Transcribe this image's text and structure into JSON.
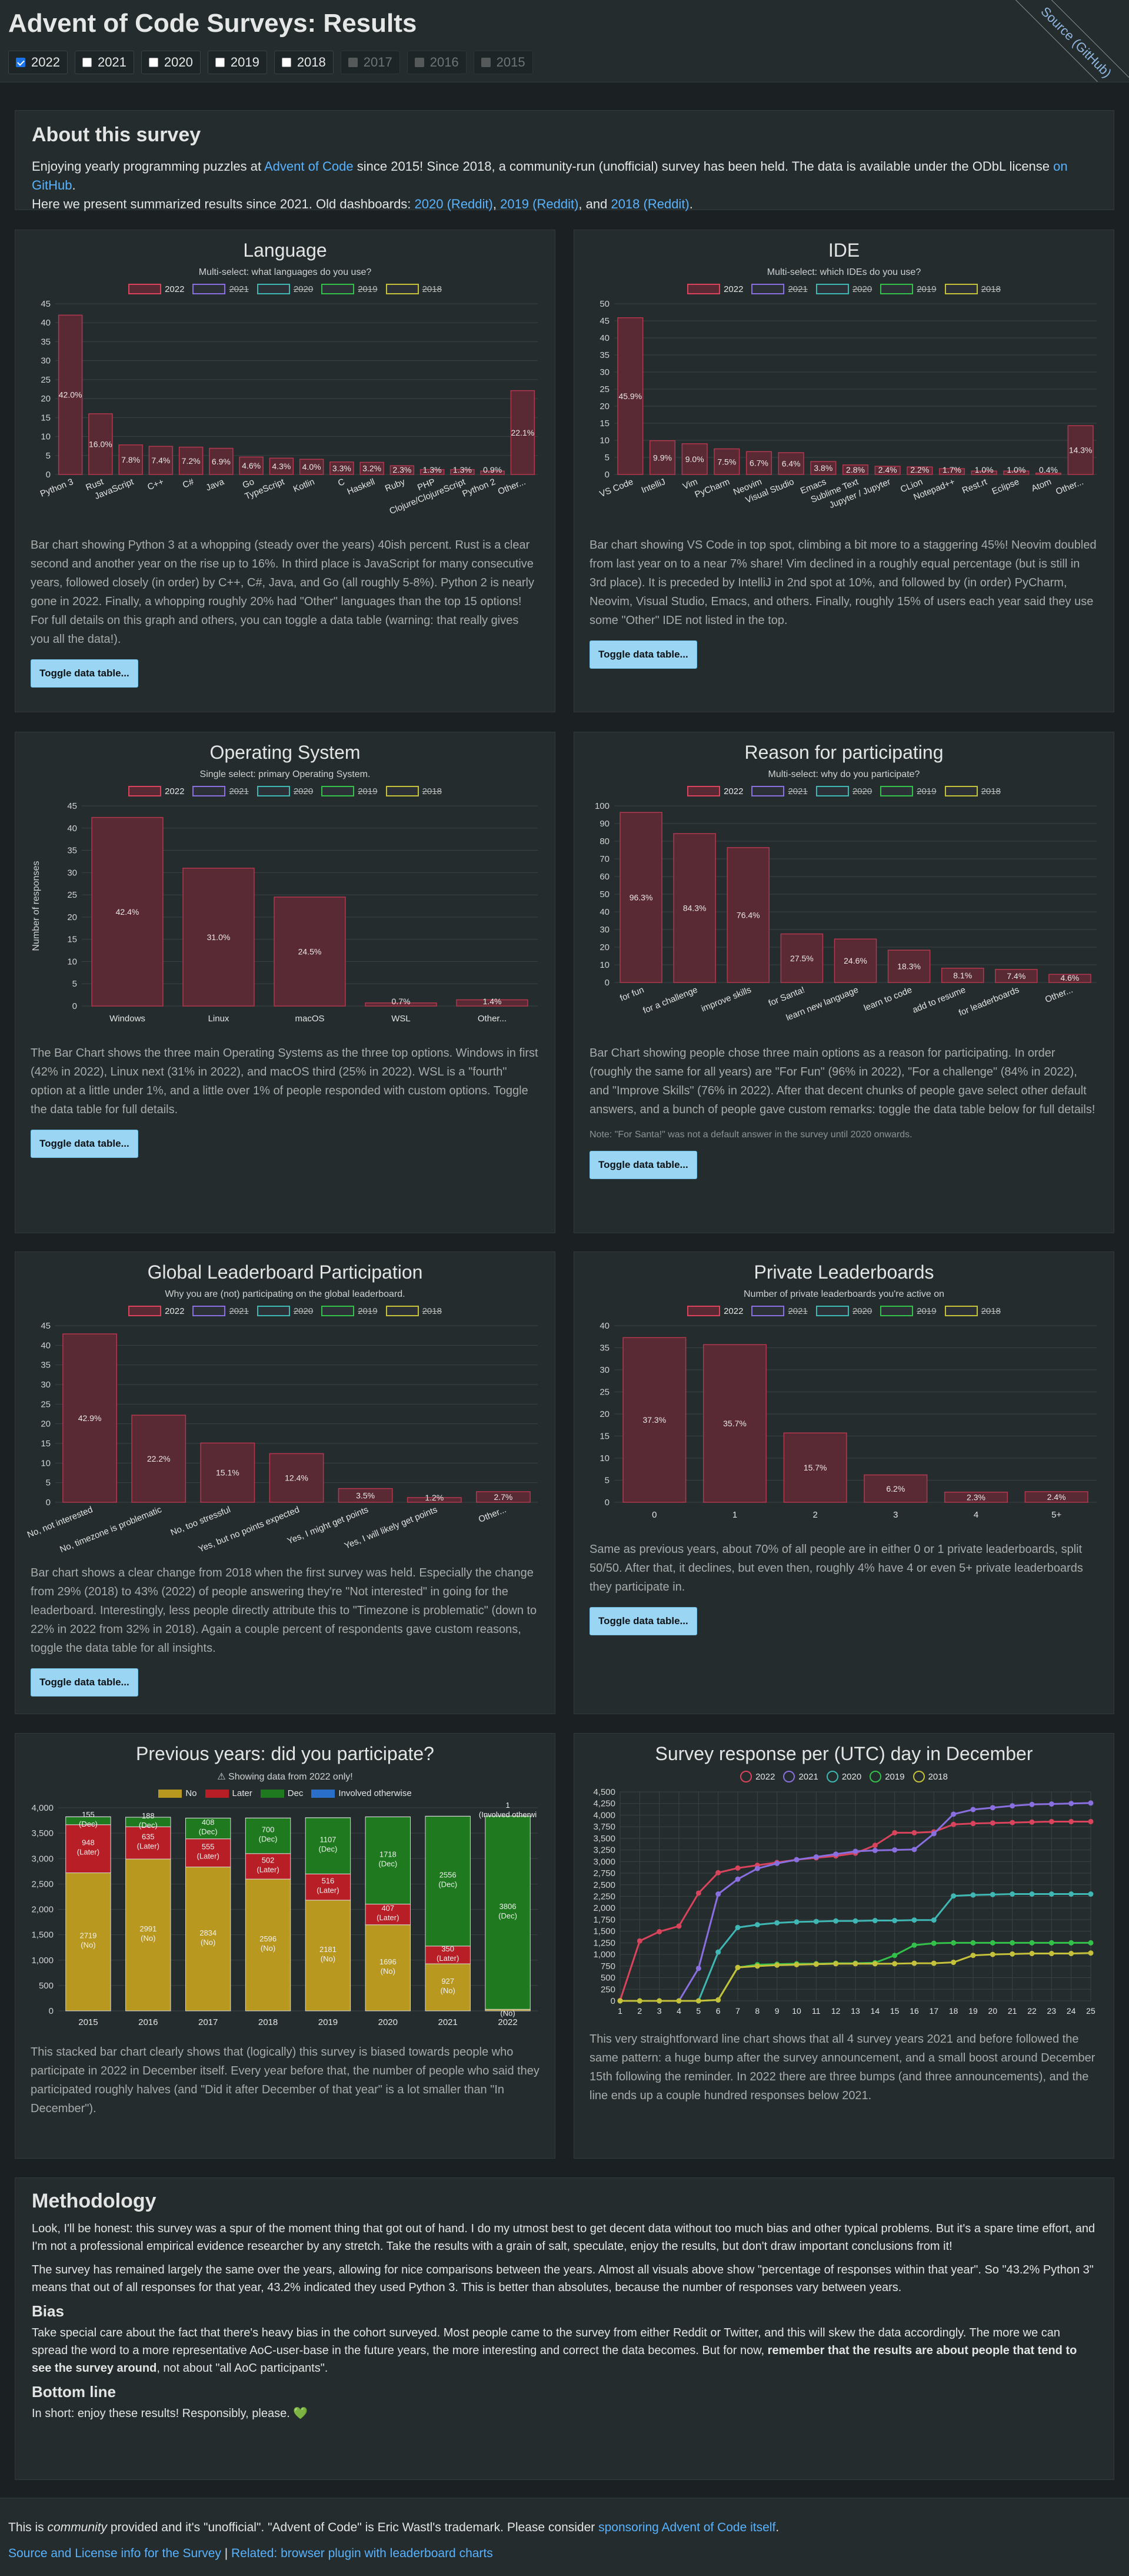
{
  "header": {
    "title": "Advent of Code Surveys: Results",
    "ribbon": "Source (GitHub)",
    "years": [
      {
        "label": "2022",
        "checked": true,
        "disabled": false
      },
      {
        "label": "2021",
        "checked": false,
        "disabled": false
      },
      {
        "label": "2020",
        "checked": false,
        "disabled": false
      },
      {
        "label": "2019",
        "checked": false,
        "disabled": false
      },
      {
        "label": "2018",
        "checked": false,
        "disabled": false
      },
      {
        "label": "2017",
        "checked": false,
        "disabled": true
      },
      {
        "label": "2016",
        "checked": false,
        "disabled": true
      },
      {
        "label": "2015",
        "checked": false,
        "disabled": true
      }
    ]
  },
  "about": {
    "title": "About this survey",
    "p1": "Enjoying yearly programming puzzles at ",
    "link_aoc": "Advent of Code",
    "p2": " since 2015! Since 2018, a community-run (unofficial) survey has been held. The data is available under the ODbL license ",
    "link_github": "on GitHub",
    "p3": ".",
    "p4": "Here we present summarized results since 2021. Old dashboards: ",
    "link_2020": "2020 (Reddit)",
    "sep1": ", ",
    "link_2019": "2019 (Reddit)",
    "sep2": ", and ",
    "link_2018": "2018 (Reddit)",
    "p5": "."
  },
  "legend_years": [
    "2022",
    "2021",
    "2020",
    "2019",
    "2018"
  ],
  "colors": {
    "y2022": "#d9435c",
    "y2021": "#8a6fe0",
    "y2020": "#3fb7b4",
    "y2019": "#33c14a",
    "y2018": "#c6c13a",
    "bar_fill": "#5a2a34",
    "bar_stroke": "#b3384f",
    "no": "#b8981e",
    "later": "#b81e26",
    "dec": "#1f7a1f",
    "other": "#2a6fc9"
  },
  "toggle_label": "Toggle data table...",
  "language": {
    "title": "Language",
    "subtitle": "Multi-select: what languages do you use?",
    "desc": "Bar chart showing Python 3 at a whopping (steady over the years) 40ish percent. Rust is a clear second and another year on the rise up to 16%. In third place is JavaScript for many consecutive years, followed closely (in order) by C++, C#, Java, and Go (all roughly 5-8%). Python 2 is nearly gone in 2022. Finally, a whopping roughly 20% had \"Other\" languages than the top 15 options! For full details on this graph and others, you can toggle a data table (warning: that really gives you all the data!)."
  },
  "ide": {
    "title": "IDE",
    "subtitle": "Multi-select: which IDEs do you use?",
    "desc": "Bar chart showing VS Code in top spot, climbing a bit more to a staggering 45%! Neovim doubled from last year on to a near 7% share! Vim declined in a roughly equal percentage (but is still in 3rd place). It is preceded by IntelliJ in 2nd spot at 10%, and followed by (in order) PyCharm, Neovim, Visual Studio, Emacs, and others. Finally, roughly 15% of users each year said they use some \"Other\" IDE not listed in the top."
  },
  "os": {
    "title": "Operating System",
    "subtitle": "Single select: primary Operating System.",
    "ylabel": "Number of responses",
    "desc": "The Bar Chart shows the three main Operating Systems as the three top options. Windows in first (42% in 2022), Linux next (31% in 2022), and macOS third (25% in 2022). WSL is a \"fourth\" option at a little under 1%, and a little over 1% of people responded with custom options. Toggle the data table for full details."
  },
  "reason": {
    "title": "Reason for participating",
    "subtitle": "Multi-select: why do you participate?",
    "desc": "Bar Chart showing people chose three main options as a reason for participating. In order (roughly the same for all years) are \"For Fun\" (96% in 2022), \"For a challenge\" (84% in 2022), and \"Improve Skills\" (76% in 2022). After that decent chunks of people gave select other default answers, and a bunch of people gave custom remarks: toggle the data table below for full details!",
    "note": "Note: \"For Santa!\" was not a default answer in the survey until 2020 onwards."
  },
  "global": {
    "title": "Global Leaderboard Participation",
    "subtitle": "Why you are (not) participating on the global leaderboard.",
    "desc": "Bar chart shows a clear change from 2018 when the first survey was held. Especially the change from 29% (2018) to 43% (2022) of people answering they're \"Not interested\" in going for the leaderboard. Interestingly, less people directly attribute this to \"Timezone is problematic\" (down to 22% in 2022 from 32% in 2018). Again a couple percent of respondents gave custom reasons, toggle the data table for all insights."
  },
  "private": {
    "title": "Private Leaderboards",
    "subtitle": "Number of private leaderboards you're active on",
    "desc": "Same as previous years, about 70% of all people are in either 0 or 1 private leaderboards, split 50/50. After that, it declines, but even then, roughly 4% have 4 or even 5+ private leaderboards they participate in."
  },
  "previous": {
    "title": "Previous years: did you participate?",
    "warning": "⚠ Showing data from 2022 only!",
    "legend": [
      "No",
      "Later",
      "Dec",
      "Involved otherwise"
    ],
    "desc": "This stacked bar chart clearly shows that (logically) this survey is biased towards people who participate in 2022 in December itself. Every year before that, the number of people who said they participated roughly halves (and \"Did it after December of that year\" is a lot smaller than \"In December\")."
  },
  "daily": {
    "title": "Survey response per (UTC) day in December",
    "desc": "This very straightforward line chart shows that all 4 survey years 2021 and before followed the same pattern: a huge bump after the survey announcement, and a small boost around December 15th following the reminder. In 2022 there are three bumps (and three announcements), and the line ends up a couple hundred responses below 2021."
  },
  "method": {
    "title": "Methodology",
    "p1": "Look, I'll be honest: this survey was a spur of the moment thing that got out of hand. I do my utmost best to get decent data without too much bias and other typical problems. But it's a spare time effort, and I'm not a professional empirical evidence researcher by any stretch. Take the results with a grain of salt, speculate, enjoy the results, but don't draw important conclusions from it!",
    "p2": "The survey has remained largely the same over the years, allowing for nice comparisons between the years. Almost all visuals above show \"percentage of responses within that year\". So \"43.2% Python 3\" means that out of all responses for that year, 43.2% indicated they used Python 3. This is better than absolutes, because the number of responses vary between years.",
    "bias_title": "Bias",
    "p3a": "Take special care about the fact that there's heavy bias in the cohort surveyed. Most people came to the survey from either Reddit or Twitter, and this will skew the data accordingly. The more we can spread the word to a more representative AoC-user-base in the future years, the more interesting and correct the data becomes. But for now, ",
    "p3b": "remember that the results are about people that tend to see the survey around",
    "p3c": ", not about \"all AoC participants\".",
    "bottom_title": "Bottom line",
    "p4": "In short: enjoy these results! Responsibly, please. 💚"
  },
  "footer": {
    "t1": "This is ",
    "t1i": "community",
    "t2": " provided and it's \"unofficial\". \"Advent of Code\" is Eric Wastl's trademark. Please consider ",
    "link_sponsor": "sponsoring Advent of Code itself",
    "t3": ".",
    "link_source": "Source and License info for the Survey",
    "sep": " | ",
    "link_related": "Related: browser plugin with leaderboard charts"
  },
  "chart_data": [
    {
      "id": "language",
      "type": "bar",
      "categories": [
        "Python 3",
        "Rust",
        "JavaScript",
        "C++",
        "C#",
        "Java",
        "Go",
        "TypeScript",
        "Kotlin",
        "C",
        "Haskell",
        "Ruby",
        "PHP",
        "Clojure/ClojureScript",
        "Python 2",
        "Other..."
      ],
      "values": [
        42.0,
        16.0,
        7.8,
        7.4,
        7.2,
        6.9,
        4.6,
        4.3,
        4.0,
        3.3,
        3.2,
        2.3,
        1.3,
        1.3,
        0.9,
        22.1
      ],
      "labels": [
        "42.0%",
        "16.0%",
        "7.8%",
        "7.4%",
        "7.2%",
        "6.9%",
        "4.6%",
        "4.3%",
        "4.0%",
        "3.3%",
        "3.2%",
        "2.3%",
        "1.3%",
        "1.3%",
        "0.9%",
        "22.1%"
      ],
      "ylim": [
        0,
        45
      ],
      "yticks": [
        0,
        5,
        10,
        15,
        20,
        25,
        30,
        35,
        40,
        45
      ]
    },
    {
      "id": "ide",
      "type": "bar",
      "categories": [
        "VS Code",
        "IntelliJ",
        "Vim",
        "PyCharm",
        "Neovim",
        "Visual Studio",
        "Emacs",
        "Sublime Text",
        "Jupyter / Jupyter",
        "CLion",
        "Notepad++",
        "Rest.rt",
        "Eclipse",
        "Atom",
        "Other..."
      ],
      "values": [
        45.9,
        9.9,
        9.0,
        7.5,
        6.7,
        6.4,
        3.8,
        2.8,
        2.4,
        2.2,
        1.7,
        1.0,
        1.0,
        0.4,
        14.3
      ],
      "labels": [
        "45.9%",
        "9.9%",
        "9.0%",
        "7.5%",
        "6.7%",
        "6.4%",
        "3.8%",
        "2.8%",
        "2.4%",
        "2.2%",
        "1.7%",
        "1.0%",
        "1.0%",
        "0.4%",
        "14.3%"
      ],
      "ylim": [
        0,
        50
      ],
      "yticks": [
        0,
        5,
        10,
        15,
        20,
        25,
        30,
        35,
        40,
        45,
        50
      ]
    },
    {
      "id": "os",
      "type": "bar",
      "categories": [
        "Windows",
        "Linux",
        "macOS",
        "WSL",
        "Other..."
      ],
      "values": [
        42.4,
        31.0,
        24.5,
        0.7,
        1.4
      ],
      "labels": [
        "42.4%",
        "31.0%",
        "24.5%",
        "0.7%",
        "1.4%"
      ],
      "ylabel": "Number of responses",
      "ylim": [
        0,
        45
      ],
      "yticks": [
        0,
        5,
        10,
        15,
        20,
        25,
        30,
        35,
        40,
        45
      ]
    },
    {
      "id": "reason",
      "type": "bar",
      "categories": [
        "for fun",
        "for a challenge",
        "improve skills",
        "for Santa!",
        "learn new language",
        "learn to code",
        "add to resume",
        "for leaderboards",
        "Other..."
      ],
      "values": [
        96.3,
        84.3,
        76.4,
        27.5,
        24.6,
        18.3,
        8.1,
        7.4,
        4.6
      ],
      "labels": [
        "96.3%",
        "84.3%",
        "76.4%",
        "27.5%",
        "24.6%",
        "18.3%",
        "8.1%",
        "7.4%",
        "4.6%"
      ],
      "ylim": [
        0,
        100
      ],
      "yticks": [
        0,
        10,
        20,
        30,
        40,
        50,
        60,
        70,
        80,
        90,
        100
      ]
    },
    {
      "id": "global",
      "type": "bar",
      "categories": [
        "No, not interested",
        "No, timezone is problematic",
        "No, too stressful",
        "Yes, but no points expected",
        "Yes, I might get points",
        "Yes, I will likely get points",
        "Other..."
      ],
      "values": [
        42.9,
        22.2,
        15.1,
        12.4,
        3.5,
        1.2,
        2.7
      ],
      "labels": [
        "42.9%",
        "22.2%",
        "15.1%",
        "12.4%",
        "3.5%",
        "1.2%",
        "2.7%"
      ],
      "ylim": [
        0,
        45
      ],
      "yticks": [
        0,
        5,
        10,
        15,
        20,
        25,
        30,
        35,
        40,
        45
      ]
    },
    {
      "id": "private",
      "type": "bar",
      "categories": [
        "0",
        "1",
        "2",
        "3",
        "4",
        "5+"
      ],
      "values": [
        37.3,
        35.7,
        15.7,
        6.2,
        2.3,
        2.4
      ],
      "labels": [
        "37.3%",
        "35.7%",
        "15.7%",
        "6.2%",
        "2.3%",
        "2.4%"
      ],
      "ylim": [
        0,
        40
      ],
      "yticks": [
        0,
        5,
        10,
        15,
        20,
        25,
        30,
        35,
        40
      ]
    },
    {
      "id": "previous",
      "type": "bar",
      "stacked": true,
      "categories": [
        "2015",
        "2016",
        "2017",
        "2018",
        "2019",
        "2020",
        "2021",
        "2022"
      ],
      "series": [
        {
          "name": "No",
          "values": [
            2719,
            2991,
            2834,
            2596,
            2181,
            1696,
            927,
            31
          ],
          "labels": [
            "2719\n(No)",
            "2991\n(No)",
            "2834\n(No)",
            "2596\n(No)",
            "2181\n(No)",
            "1696\n(No)",
            "927\n(No)",
            "31\n(No)"
          ]
        },
        {
          "name": "Later",
          "values": [
            948,
            635,
            555,
            502,
            516,
            407,
            350,
            0
          ],
          "labels": [
            "948\n(Later)",
            "635\n(Later)",
            "555\n(Later)",
            "502\n(Later)",
            "516\n(Later)",
            "407\n(Later)",
            "350\n(Later)",
            ""
          ]
        },
        {
          "name": "Dec",
          "values": [
            155,
            188,
            408,
            700,
            1107,
            1718,
            2556,
            3806
          ],
          "labels": [
            "155\n(Dec)",
            "188\n(Dec)",
            "408\n(Dec)",
            "700\n(Dec)",
            "1107\n(Dec)",
            "1718\n(Dec)",
            "2556\n(Dec)",
            "3806\n(Dec)"
          ]
        },
        {
          "name": "Involved otherwise",
          "values": [
            1,
            1,
            1,
            1,
            1,
            1,
            1,
            1
          ],
          "labels": [
            "",
            "",
            "",
            "",
            "",
            "",
            "",
            "1\n(Involved otherwi"
          ]
        }
      ],
      "ylim": [
        0,
        4000
      ],
      "yticks": [
        0,
        500,
        1000,
        1500,
        2000,
        2500,
        3000,
        3500,
        4000
      ]
    },
    {
      "id": "daily",
      "type": "line",
      "x": [
        1,
        2,
        3,
        4,
        5,
        6,
        7,
        8,
        9,
        10,
        11,
        12,
        13,
        14,
        15,
        16,
        17,
        18,
        19,
        20,
        21,
        22,
        23,
        24,
        25
      ],
      "series": [
        {
          "name": "2022",
          "values": [
            10,
            1290,
            1490,
            1610,
            2320,
            2760,
            2860,
            2920,
            2980,
            3040,
            3080,
            3120,
            3180,
            3350,
            3620,
            3620,
            3640,
            3800,
            3820,
            3830,
            3840,
            3850,
            3860,
            3860,
            3860
          ]
        },
        {
          "name": "2021",
          "values": [
            0,
            0,
            0,
            0,
            700,
            2300,
            2620,
            2850,
            2960,
            3040,
            3100,
            3160,
            3220,
            3240,
            3250,
            3260,
            3600,
            4020,
            4120,
            4160,
            4200,
            4230,
            4240,
            4250,
            4260
          ]
        },
        {
          "name": "2020",
          "values": [
            0,
            0,
            0,
            0,
            0,
            1050,
            1580,
            1640,
            1680,
            1700,
            1710,
            1720,
            1720,
            1730,
            1730,
            1740,
            1740,
            2260,
            2280,
            2290,
            2300,
            2300,
            2300,
            2300,
            2300
          ]
        },
        {
          "name": "2019",
          "values": [
            0,
            0,
            0,
            0,
            0,
            20,
            720,
            780,
            790,
            800,
            800,
            810,
            810,
            820,
            980,
            1200,
            1240,
            1250,
            1250,
            1250,
            1250,
            1250,
            1250,
            1250,
            1250
          ]
        },
        {
          "name": "2018",
          "values": [
            0,
            0,
            0,
            0,
            0,
            20,
            720,
            750,
            770,
            780,
            790,
            800,
            800,
            800,
            800,
            810,
            810,
            830,
            980,
            1000,
            1010,
            1020,
            1020,
            1020,
            1030
          ]
        }
      ],
      "ylim": [
        0,
        4500
      ],
      "yticks": [
        0,
        250,
        500,
        750,
        1000,
        1250,
        1500,
        1750,
        2000,
        2250,
        2500,
        2750,
        3000,
        3250,
        3500,
        3750,
        4000,
        4250,
        4500
      ]
    }
  ]
}
